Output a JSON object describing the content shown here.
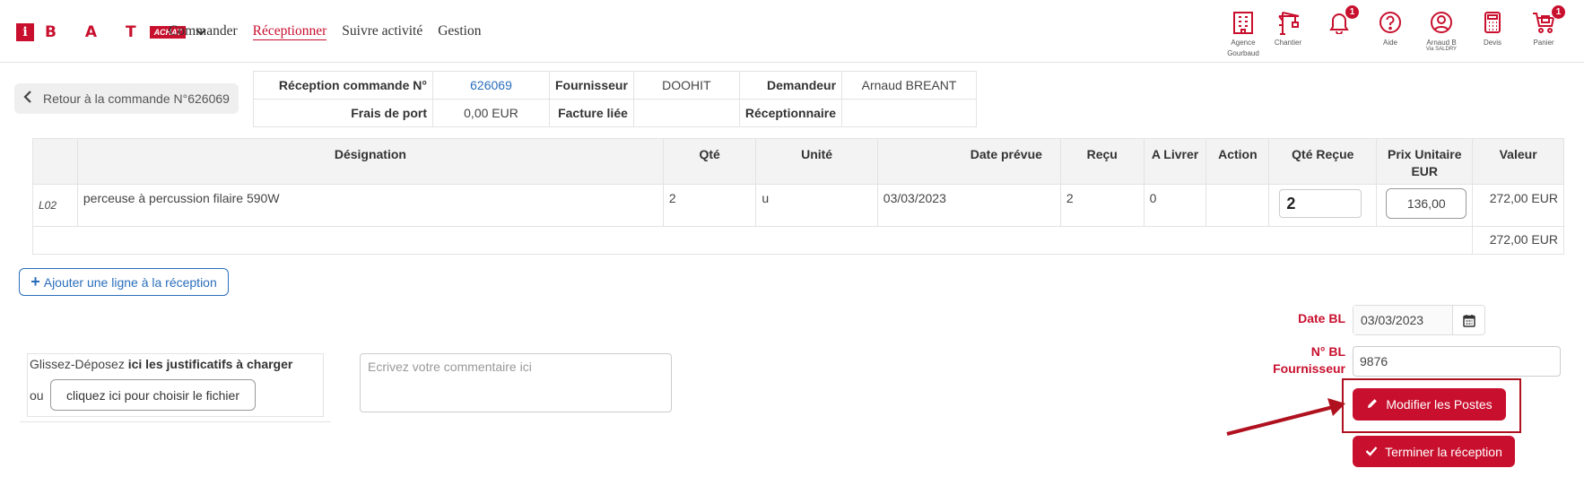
{
  "brand": {
    "letters": "B A T",
    "tag": "ACHAT",
    "initial": "i"
  },
  "nav": [
    "Commander",
    "Réceptionner",
    "Suivre activité",
    "Gestion"
  ],
  "header_icons": [
    {
      "name": "agency-icon",
      "label": "Agence",
      "sublabel": "Gourbaud"
    },
    {
      "name": "crane-icon",
      "label": "Chantier",
      "sublabel": ""
    },
    {
      "name": "bell-icon",
      "label": "",
      "sublabel": "",
      "badge": "1"
    },
    {
      "name": "help-icon",
      "label": "Aide",
      "sublabel": ""
    },
    {
      "name": "user-icon",
      "label": "Arnaud B",
      "sublabel": "Via SALDRY"
    },
    {
      "name": "calculator-icon",
      "label": "Devis",
      "sublabel": ""
    },
    {
      "name": "cart-icon",
      "label": "Panier",
      "sublabel": "",
      "badge": "1"
    }
  ],
  "back_label": "Retour à la commande N°626069",
  "info": {
    "reception_label": "Réception commande N°",
    "reception_value": "626069",
    "fournisseur_label": "Fournisseur",
    "fournisseur_value": "DOOHIT",
    "demandeur_label": "Demandeur",
    "demandeur_value": "Arnaud BREANT",
    "frais_label": "Frais de port",
    "frais_value": "0,00 EUR",
    "facture_label": "Facture liée",
    "facture_value": "",
    "receptionnaire_label": "Réceptionnaire",
    "receptionnaire_value": ""
  },
  "table": {
    "headers": [
      "",
      "Désignation",
      "Qté",
      "Unité",
      "Date prévue",
      "Reçu",
      "A Livrer",
      "Action",
      "Qté Reçue",
      "Prix Unitaire EUR",
      "Valeur"
    ],
    "rows": [
      {
        "ref": "L02",
        "designation": "perceuse à percussion filaire 590W",
        "qte": "2",
        "unite": "u",
        "date": "03/03/2023",
        "recu": "2",
        "a_livrer": "0",
        "action": "",
        "qte_recue": "2",
        "prix": "136,00",
        "valeur": "272,00 EUR"
      }
    ],
    "total": "272,00 EUR"
  },
  "add_line_label": "Ajouter une ligne à la réception",
  "dropzone": {
    "text_pre": "Glissez-Déposez ",
    "text_bold": "ici les justificatifs à charger",
    "ou": "ou",
    "choose_label": "cliquez ici pour choisir le fichier"
  },
  "comment_placeholder": "Ecrivez votre commentaire ici",
  "form": {
    "date_bl_label": "Date BL",
    "date_bl_value": "03/03/2023",
    "bl_label_line1": "N° BL",
    "bl_label_line2": "Fournisseur",
    "bl_value": "9876",
    "modify_label": "Modifier les Postes",
    "finish_label": "Terminer la réception"
  },
  "colors": {
    "brand": "#c8102e",
    "link": "#2a6ebb"
  }
}
